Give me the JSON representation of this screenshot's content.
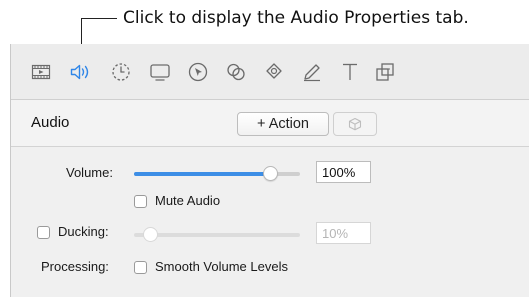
{
  "callout": {
    "text": "Click to display the Audio Properties tab."
  },
  "toolbar": {
    "icons": [
      {
        "name": "film-icon"
      },
      {
        "name": "audio-speaker-icon",
        "selected": true,
        "color": "#2f86e8"
      },
      {
        "name": "timer-icon"
      },
      {
        "name": "display-icon"
      },
      {
        "name": "cursor-icon"
      },
      {
        "name": "annotation-icon"
      },
      {
        "name": "transitions-icon"
      },
      {
        "name": "pencil-icon"
      },
      {
        "name": "text-icon"
      },
      {
        "name": "properties-icon"
      }
    ]
  },
  "header": {
    "title": "Audio",
    "action_label": "+ Action"
  },
  "volume": {
    "label": "Volume:",
    "value_text": "100%",
    "level": 0.82
  },
  "mute": {
    "label": "Mute Audio",
    "checked": false
  },
  "ducking": {
    "label": "Ducking:",
    "checked": false,
    "value_text": "10%",
    "level": 0.1,
    "disabled": true
  },
  "processing": {
    "label": "Processing:",
    "smooth_label": "Smooth Volume Levels",
    "checked": false
  },
  "colors": {
    "accent": "#2f86e8",
    "panel_bg": "#f0f0f0"
  }
}
